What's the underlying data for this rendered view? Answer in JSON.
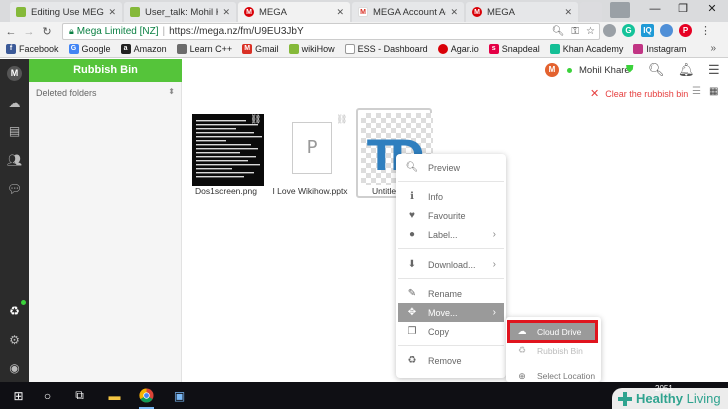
{
  "browser": {
    "tabs": [
      {
        "title": "Editing Use MEGA O",
        "favicon": "wikihow"
      },
      {
        "title": "User_talk: Mohil Kha",
        "favicon": "wikihow"
      },
      {
        "title": "MEGA",
        "favicon": "mega"
      },
      {
        "title": "MEGA Account Activ",
        "favicon": "gmail"
      },
      {
        "title": "MEGA",
        "favicon": "mega"
      }
    ],
    "close_glyph": "✕",
    "address": {
      "secure_label": "Mega Limited [NZ]",
      "url": "https://mega.nz/fm/U9EU3JbY"
    },
    "bookmarks": [
      {
        "label": "Facebook",
        "color": "#3b5998",
        "glyph": "f"
      },
      {
        "label": "Google",
        "color": "#4285f4",
        "glyph": "G"
      },
      {
        "label": "Amazon",
        "color": "#222222",
        "glyph": "a"
      },
      {
        "label": "Learn C++",
        "color": "#6b6b6b",
        "glyph": ""
      },
      {
        "label": "Gmail",
        "color": "#d93025",
        "glyph": "M"
      },
      {
        "label": "wikiHow",
        "color": "#85b93a",
        "glyph": ""
      },
      {
        "label": "ESS - Dashboard",
        "color": "#888888",
        "glyph": ""
      },
      {
        "label": "Agar.io",
        "color": "#d90007",
        "glyph": ""
      },
      {
        "label": "Snapdeal",
        "color": "#e40046",
        "glyph": "s"
      },
      {
        "label": "Khan Academy",
        "color": "#14bf96",
        "glyph": ""
      },
      {
        "label": "Instagram",
        "color": "#c13584",
        "glyph": ""
      }
    ],
    "bookmarks_more": "»"
  },
  "mega": {
    "section_title": "Rubbish Bin",
    "tree_label": "Deleted folders",
    "user_initial": "M",
    "user_name": "Mohil Khare",
    "clear_label": "Clear the rubbish bin",
    "files": [
      {
        "name": "Dos1screen.png",
        "type": "image"
      },
      {
        "name": "I Love Wikihow.pptx",
        "type": "document",
        "glyph": "P"
      },
      {
        "name": "Untitle",
        "type": "image"
      }
    ],
    "context_menu": [
      {
        "label": "Preview",
        "icon": "search-icon",
        "glyph": "🔍︎",
        "submenu": false
      },
      {
        "label": "Info",
        "icon": "info-icon",
        "glyph": "ℹ",
        "submenu": false
      },
      {
        "label": "Favourite",
        "icon": "heart-icon",
        "glyph": "♥",
        "submenu": false
      },
      {
        "label": "Label...",
        "icon": "label-icon",
        "glyph": "●",
        "submenu": true
      },
      {
        "label": "Download...",
        "icon": "download-icon",
        "glyph": "⬇",
        "submenu": true
      },
      {
        "label": "Rename",
        "icon": "pencil-icon",
        "glyph": "✎",
        "submenu": false
      },
      {
        "label": "Move...",
        "icon": "move-icon",
        "glyph": "✥",
        "submenu": true,
        "highlighted": true
      },
      {
        "label": "Copy",
        "icon": "copy-icon",
        "glyph": "❐",
        "submenu": false
      },
      {
        "label": "Remove",
        "icon": "recycle-icon",
        "glyph": "♻",
        "submenu": false
      }
    ],
    "move_submenu": [
      {
        "label": "Cloud Drive",
        "icon": "cloud-icon",
        "glyph": "☁",
        "highlighted": true
      },
      {
        "label": "Rubbish Bin",
        "icon": "recycle-icon",
        "glyph": "♻"
      },
      {
        "label": "Select Location",
        "icon": "location-icon",
        "glyph": "⊕"
      }
    ]
  },
  "taskbar": {
    "clock": "2051"
  },
  "watermark": {
    "brand_bold": "Healthy",
    "brand_light": "Living"
  },
  "colors": {
    "mega_green": "#55c43a",
    "danger_red": "#e64040",
    "highlight_box": "#e0141e",
    "menu_highlight": "#9a9a9a"
  }
}
